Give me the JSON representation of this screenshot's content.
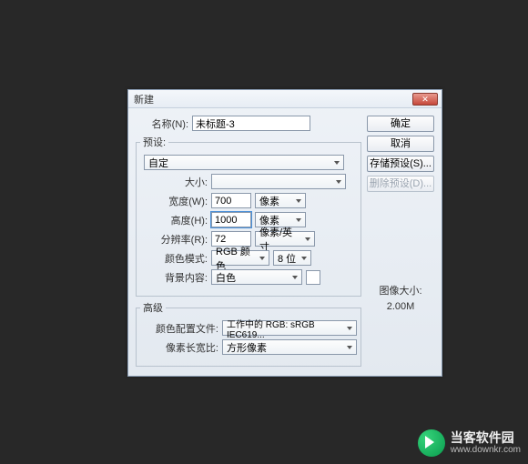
{
  "dialog": {
    "title": "新建",
    "close_icon": "✕"
  },
  "fields": {
    "name_label": "名称(N):",
    "name_value": "未标题-3",
    "preset_label": "预设:",
    "preset_value": "自定",
    "size_label": "大小:",
    "size_value": "",
    "width_label": "宽度(W):",
    "width_value": "700",
    "width_unit": "像素",
    "height_label": "高度(H):",
    "height_value": "1000",
    "height_unit": "像素",
    "resolution_label": "分辨率(R):",
    "resolution_value": "72",
    "resolution_unit": "像素/英寸",
    "color_mode_label": "颜色模式:",
    "color_mode_value": "RGB 颜色",
    "color_depth_value": "8 位",
    "bg_label": "背景内容:",
    "bg_value": "白色"
  },
  "advanced": {
    "legend": "高级",
    "profile_label": "颜色配置文件:",
    "profile_value": "工作中的 RGB: sRGB IEC619...",
    "aspect_label": "像素长宽比:",
    "aspect_value": "方形像素"
  },
  "buttons": {
    "ok": "确定",
    "cancel": "取消",
    "save_preset": "存储预设(S)...",
    "delete_preset": "删除预设(D)..."
  },
  "image_size": {
    "label": "图像大小:",
    "value": "2.00M"
  },
  "watermark": {
    "name": "当客软件园",
    "url": "www.downkr.com"
  }
}
